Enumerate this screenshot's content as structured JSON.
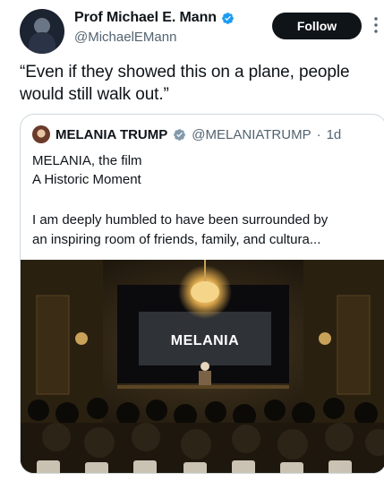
{
  "author": {
    "display_name": "Prof Michael E. Mann",
    "handle": "@MichaelEMann",
    "verified": true,
    "verified_color": "#1d9bf0"
  },
  "follow_label": "Follow",
  "tweet_text": "“Even if they showed this on a plane, people would still walk out.”",
  "quote": {
    "display_name": "MELANIA TRUMP",
    "handle": "@MELANIATRUMP",
    "separator": "·",
    "time": "1d",
    "verified": true,
    "verified_color": "#829aab",
    "lines": [
      "MELANIA, the film",
      "A Historic Moment",
      "I am deeply humbled to have been surrounded by",
      "an inspiring room of friends, family, and cultura..."
    ],
    "media": {
      "screen_text": "MELANIA"
    }
  },
  "icons": {
    "verified": "verified-check-icon",
    "more": "more-vertical-icon"
  }
}
